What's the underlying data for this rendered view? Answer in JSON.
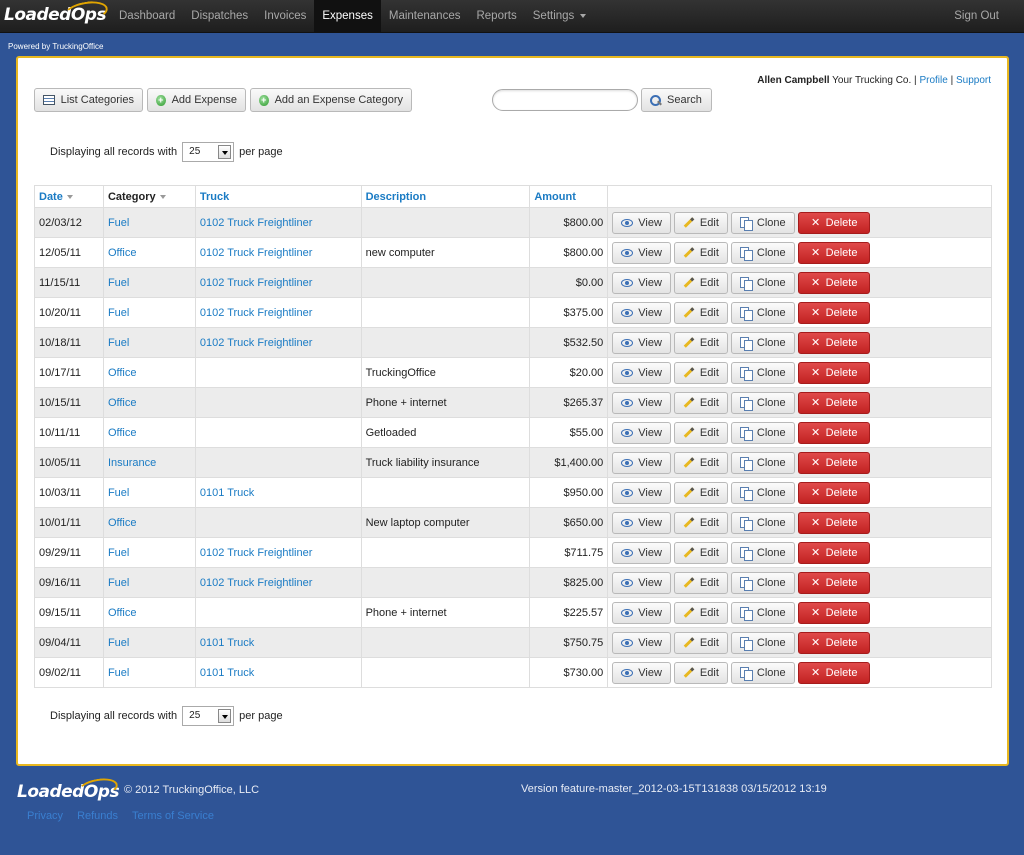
{
  "nav": {
    "brand_loaded": "Loaded",
    "brand_ops": "Ops",
    "items": [
      {
        "label": "Dashboard"
      },
      {
        "label": "Dispatches"
      },
      {
        "label": "Invoices"
      },
      {
        "label": "Expenses",
        "active": true
      },
      {
        "label": "Maintenances"
      },
      {
        "label": "Reports"
      },
      {
        "label": "Settings"
      }
    ],
    "signout": "Sign Out"
  },
  "powered_by": "Powered by TruckingOffice",
  "user": {
    "name": "Allen Campbell",
    "company": "Your Trucking Co.",
    "sep1": "|",
    "profile": "Profile",
    "sep2": "|",
    "support": "Support"
  },
  "toolbar": {
    "list_categories": "List Categories",
    "add_expense": "Add Expense",
    "add_category": "Add an Expense Category",
    "search_value": "",
    "search_button": "Search"
  },
  "pagination": {
    "prefix": "Displaying all records with",
    "per_page_value": "25",
    "suffix": "per page"
  },
  "table": {
    "headers": {
      "date": "Date",
      "category": "Category",
      "truck": "Truck",
      "description": "Description",
      "amount": "Amount"
    },
    "actions": {
      "view": "View",
      "edit": "Edit",
      "clone": "Clone",
      "delete": "Delete"
    },
    "rows": [
      {
        "date": "02/03/12",
        "category": "Fuel",
        "truck": "0102 Truck Freightliner",
        "description": "",
        "amount": "$800.00"
      },
      {
        "date": "12/05/11",
        "category": "Office",
        "truck": "0102 Truck Freightliner",
        "description": "new computer",
        "amount": "$800.00"
      },
      {
        "date": "11/15/11",
        "category": "Fuel",
        "truck": "0102 Truck Freightliner",
        "description": "",
        "amount": "$0.00"
      },
      {
        "date": "10/20/11",
        "category": "Fuel",
        "truck": "0102 Truck Freightliner",
        "description": "",
        "amount": "$375.00"
      },
      {
        "date": "10/18/11",
        "category": "Fuel",
        "truck": "0102 Truck Freightliner",
        "description": "",
        "amount": "$532.50"
      },
      {
        "date": "10/17/11",
        "category": "Office",
        "truck": "",
        "description": "TruckingOffice",
        "amount": "$20.00"
      },
      {
        "date": "10/15/11",
        "category": "Office",
        "truck": "",
        "description": "Phone + internet",
        "amount": "$265.37"
      },
      {
        "date": "10/11/11",
        "category": "Office",
        "truck": "",
        "description": "Getloaded",
        "amount": "$55.00"
      },
      {
        "date": "10/05/11",
        "category": "Insurance",
        "truck": "",
        "description": "Truck liability insurance",
        "amount": "$1,400.00"
      },
      {
        "date": "10/03/11",
        "category": "Fuel",
        "truck": "0101 Truck",
        "description": "",
        "amount": "$950.00"
      },
      {
        "date": "10/01/11",
        "category": "Office",
        "truck": "",
        "description": "New laptop computer",
        "amount": "$650.00"
      },
      {
        "date": "09/29/11",
        "category": "Fuel",
        "truck": "0102 Truck Freightliner",
        "description": "",
        "amount": "$711.75"
      },
      {
        "date": "09/16/11",
        "category": "Fuel",
        "truck": "0102 Truck Freightliner",
        "description": "",
        "amount": "$825.00"
      },
      {
        "date": "09/15/11",
        "category": "Office",
        "truck": "",
        "description": "Phone + internet",
        "amount": "$225.57"
      },
      {
        "date": "09/04/11",
        "category": "Fuel",
        "truck": "0101 Truck",
        "description": "",
        "amount": "$750.75"
      },
      {
        "date": "09/02/11",
        "category": "Fuel",
        "truck": "0101 Truck",
        "description": "",
        "amount": "$730.00"
      }
    ]
  },
  "footer": {
    "brand_loaded": "Loaded",
    "brand_ops": "Ops",
    "copyright": "© 2012 TruckingOffice, LLC",
    "version": "Version feature-master_2012-03-15T131838 03/15/2012 13:19",
    "links": [
      {
        "label": "Privacy"
      },
      {
        "label": "Refunds"
      },
      {
        "label": "Terms of Service"
      }
    ]
  },
  "colors": {
    "page_bg": "#2f5496",
    "panel_border": "#e8b820",
    "link": "#1a7bc4",
    "delete": "#c22222"
  }
}
